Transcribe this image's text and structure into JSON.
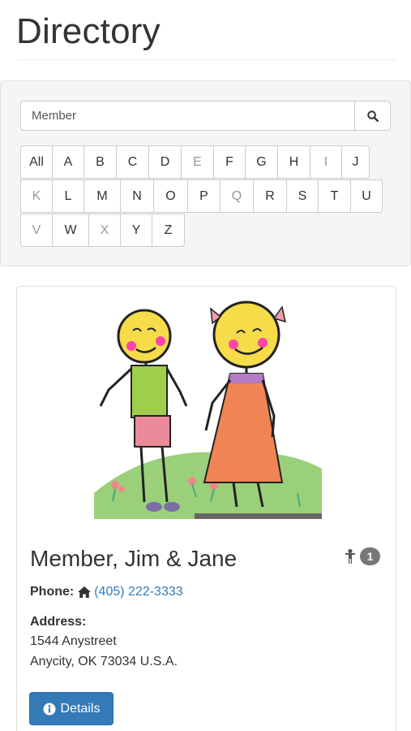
{
  "page": {
    "title": "Directory"
  },
  "search": {
    "value": "Member"
  },
  "letters": {
    "row1": [
      {
        "label": "All",
        "enabled": true
      },
      {
        "label": "A",
        "enabled": true
      },
      {
        "label": "B",
        "enabled": true
      },
      {
        "label": "C",
        "enabled": true
      },
      {
        "label": "D",
        "enabled": true
      },
      {
        "label": "E",
        "enabled": false
      },
      {
        "label": "F",
        "enabled": true
      },
      {
        "label": "G",
        "enabled": true
      },
      {
        "label": "H",
        "enabled": true
      },
      {
        "label": "I",
        "enabled": false
      },
      {
        "label": "J",
        "enabled": true
      }
    ],
    "row2": [
      {
        "label": "K",
        "enabled": false
      },
      {
        "label": "L",
        "enabled": true
      },
      {
        "label": "M",
        "enabled": true
      },
      {
        "label": "N",
        "enabled": true
      },
      {
        "label": "O",
        "enabled": true
      },
      {
        "label": "P",
        "enabled": true
      },
      {
        "label": "Q",
        "enabled": false
      },
      {
        "label": "R",
        "enabled": true
      },
      {
        "label": "S",
        "enabled": true
      },
      {
        "label": "T",
        "enabled": true
      },
      {
        "label": "U",
        "enabled": true
      }
    ],
    "row3": [
      {
        "label": "V",
        "enabled": false
      },
      {
        "label": "W",
        "enabled": true
      },
      {
        "label": "X",
        "enabled": false
      },
      {
        "label": "Y",
        "enabled": true
      },
      {
        "label": "Z",
        "enabled": true
      }
    ]
  },
  "member": {
    "name": "Member, Jim & Jane",
    "children_count": "1",
    "phone_label": "Phone:",
    "phone": "(405) 222-3333",
    "address_label": "Address:",
    "address_line1": "1544 Anystreet",
    "address_line2": "Anycity, OK 73034 U.S.A.",
    "details_label": "Details",
    "photo_icon": "family-photo"
  },
  "colors": {
    "link": "#337ab7",
    "button_primary": "#337ab7",
    "badge": "#777777",
    "disabled_letter": "#999999"
  }
}
